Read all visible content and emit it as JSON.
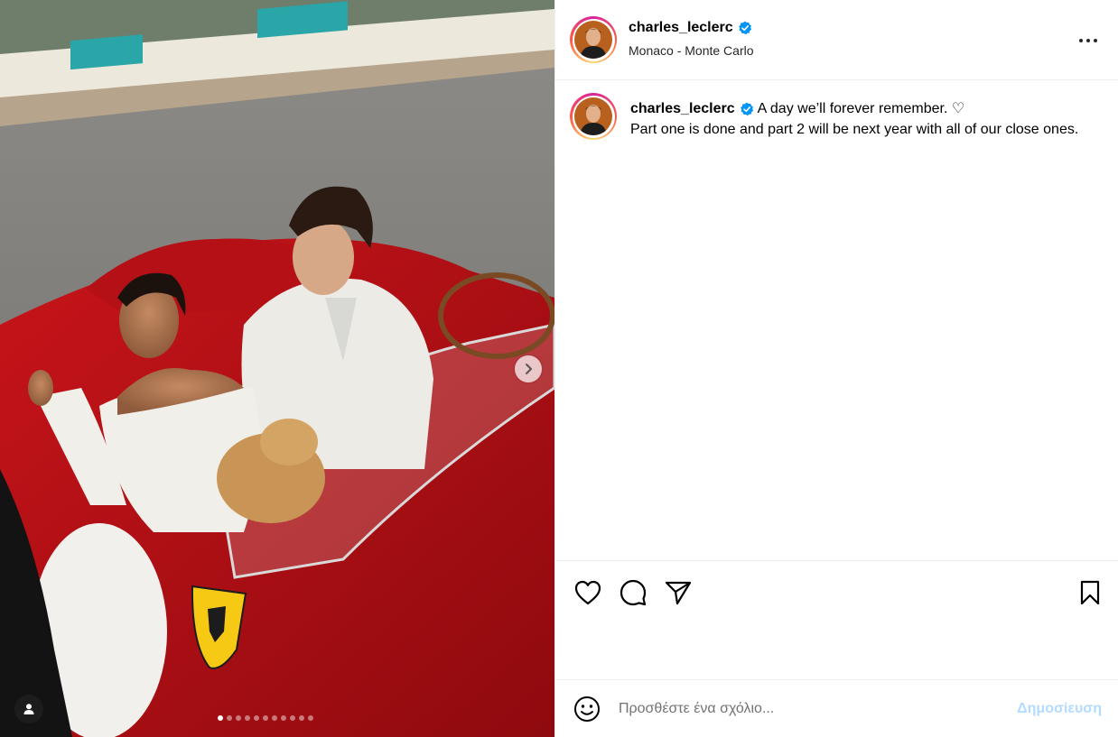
{
  "post": {
    "username": "charles_leclerc",
    "location": "Monaco - Monte Carlo",
    "verified_icon": "verified-badge-icon",
    "caption_line1": "A day we’ll forever remember. ♡",
    "caption_line2": "Part one is done and part 2 will be next year with all of our close ones.",
    "carousel_total": 11,
    "carousel_current": 1
  },
  "actions": {
    "icons": [
      "heart-icon",
      "comment-icon",
      "share-icon",
      "bookmark-icon"
    ]
  },
  "comment": {
    "placeholder": "Προσθέστε ένα σχόλιο...",
    "post_label": "Δημοσίευση"
  },
  "colors": {
    "verified": "#0095f6",
    "post_disabled": "#b3dbff",
    "divider": "#efefef"
  }
}
